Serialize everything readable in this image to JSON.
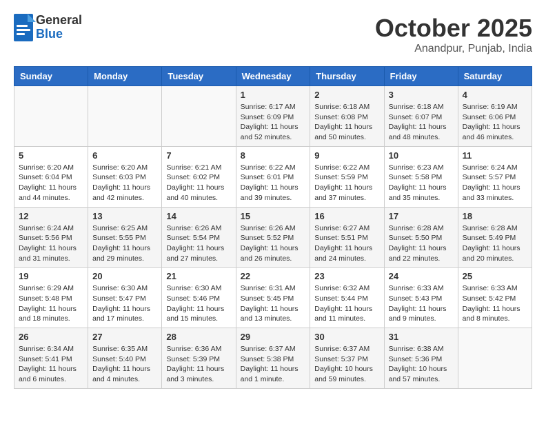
{
  "header": {
    "logo_general": "General",
    "logo_blue": "Blue",
    "month_title": "October 2025",
    "location": "Anandpur, Punjab, India"
  },
  "weekdays": [
    "Sunday",
    "Monday",
    "Tuesday",
    "Wednesday",
    "Thursday",
    "Friday",
    "Saturday"
  ],
  "weeks": [
    [
      {
        "day": "",
        "info": ""
      },
      {
        "day": "",
        "info": ""
      },
      {
        "day": "",
        "info": ""
      },
      {
        "day": "1",
        "info": "Sunrise: 6:17 AM\nSunset: 6:09 PM\nDaylight: 11 hours\nand 52 minutes."
      },
      {
        "day": "2",
        "info": "Sunrise: 6:18 AM\nSunset: 6:08 PM\nDaylight: 11 hours\nand 50 minutes."
      },
      {
        "day": "3",
        "info": "Sunrise: 6:18 AM\nSunset: 6:07 PM\nDaylight: 11 hours\nand 48 minutes."
      },
      {
        "day": "4",
        "info": "Sunrise: 6:19 AM\nSunset: 6:06 PM\nDaylight: 11 hours\nand 46 minutes."
      }
    ],
    [
      {
        "day": "5",
        "info": "Sunrise: 6:20 AM\nSunset: 6:04 PM\nDaylight: 11 hours\nand 44 minutes."
      },
      {
        "day": "6",
        "info": "Sunrise: 6:20 AM\nSunset: 6:03 PM\nDaylight: 11 hours\nand 42 minutes."
      },
      {
        "day": "7",
        "info": "Sunrise: 6:21 AM\nSunset: 6:02 PM\nDaylight: 11 hours\nand 40 minutes."
      },
      {
        "day": "8",
        "info": "Sunrise: 6:22 AM\nSunset: 6:01 PM\nDaylight: 11 hours\nand 39 minutes."
      },
      {
        "day": "9",
        "info": "Sunrise: 6:22 AM\nSunset: 5:59 PM\nDaylight: 11 hours\nand 37 minutes."
      },
      {
        "day": "10",
        "info": "Sunrise: 6:23 AM\nSunset: 5:58 PM\nDaylight: 11 hours\nand 35 minutes."
      },
      {
        "day": "11",
        "info": "Sunrise: 6:24 AM\nSunset: 5:57 PM\nDaylight: 11 hours\nand 33 minutes."
      }
    ],
    [
      {
        "day": "12",
        "info": "Sunrise: 6:24 AM\nSunset: 5:56 PM\nDaylight: 11 hours\nand 31 minutes."
      },
      {
        "day": "13",
        "info": "Sunrise: 6:25 AM\nSunset: 5:55 PM\nDaylight: 11 hours\nand 29 minutes."
      },
      {
        "day": "14",
        "info": "Sunrise: 6:26 AM\nSunset: 5:54 PM\nDaylight: 11 hours\nand 27 minutes."
      },
      {
        "day": "15",
        "info": "Sunrise: 6:26 AM\nSunset: 5:52 PM\nDaylight: 11 hours\nand 26 minutes."
      },
      {
        "day": "16",
        "info": "Sunrise: 6:27 AM\nSunset: 5:51 PM\nDaylight: 11 hours\nand 24 minutes."
      },
      {
        "day": "17",
        "info": "Sunrise: 6:28 AM\nSunset: 5:50 PM\nDaylight: 11 hours\nand 22 minutes."
      },
      {
        "day": "18",
        "info": "Sunrise: 6:28 AM\nSunset: 5:49 PM\nDaylight: 11 hours\nand 20 minutes."
      }
    ],
    [
      {
        "day": "19",
        "info": "Sunrise: 6:29 AM\nSunset: 5:48 PM\nDaylight: 11 hours\nand 18 minutes."
      },
      {
        "day": "20",
        "info": "Sunrise: 6:30 AM\nSunset: 5:47 PM\nDaylight: 11 hours\nand 17 minutes."
      },
      {
        "day": "21",
        "info": "Sunrise: 6:30 AM\nSunset: 5:46 PM\nDaylight: 11 hours\nand 15 minutes."
      },
      {
        "day": "22",
        "info": "Sunrise: 6:31 AM\nSunset: 5:45 PM\nDaylight: 11 hours\nand 13 minutes."
      },
      {
        "day": "23",
        "info": "Sunrise: 6:32 AM\nSunset: 5:44 PM\nDaylight: 11 hours\nand 11 minutes."
      },
      {
        "day": "24",
        "info": "Sunrise: 6:33 AM\nSunset: 5:43 PM\nDaylight: 11 hours\nand 9 minutes."
      },
      {
        "day": "25",
        "info": "Sunrise: 6:33 AM\nSunset: 5:42 PM\nDaylight: 11 hours\nand 8 minutes."
      }
    ],
    [
      {
        "day": "26",
        "info": "Sunrise: 6:34 AM\nSunset: 5:41 PM\nDaylight: 11 hours\nand 6 minutes."
      },
      {
        "day": "27",
        "info": "Sunrise: 6:35 AM\nSunset: 5:40 PM\nDaylight: 11 hours\nand 4 minutes."
      },
      {
        "day": "28",
        "info": "Sunrise: 6:36 AM\nSunset: 5:39 PM\nDaylight: 11 hours\nand 3 minutes."
      },
      {
        "day": "29",
        "info": "Sunrise: 6:37 AM\nSunset: 5:38 PM\nDaylight: 11 hours\nand 1 minute."
      },
      {
        "day": "30",
        "info": "Sunrise: 6:37 AM\nSunset: 5:37 PM\nDaylight: 10 hours\nand 59 minutes."
      },
      {
        "day": "31",
        "info": "Sunrise: 6:38 AM\nSunset: 5:36 PM\nDaylight: 10 hours\nand 57 minutes."
      },
      {
        "day": "",
        "info": ""
      }
    ]
  ]
}
